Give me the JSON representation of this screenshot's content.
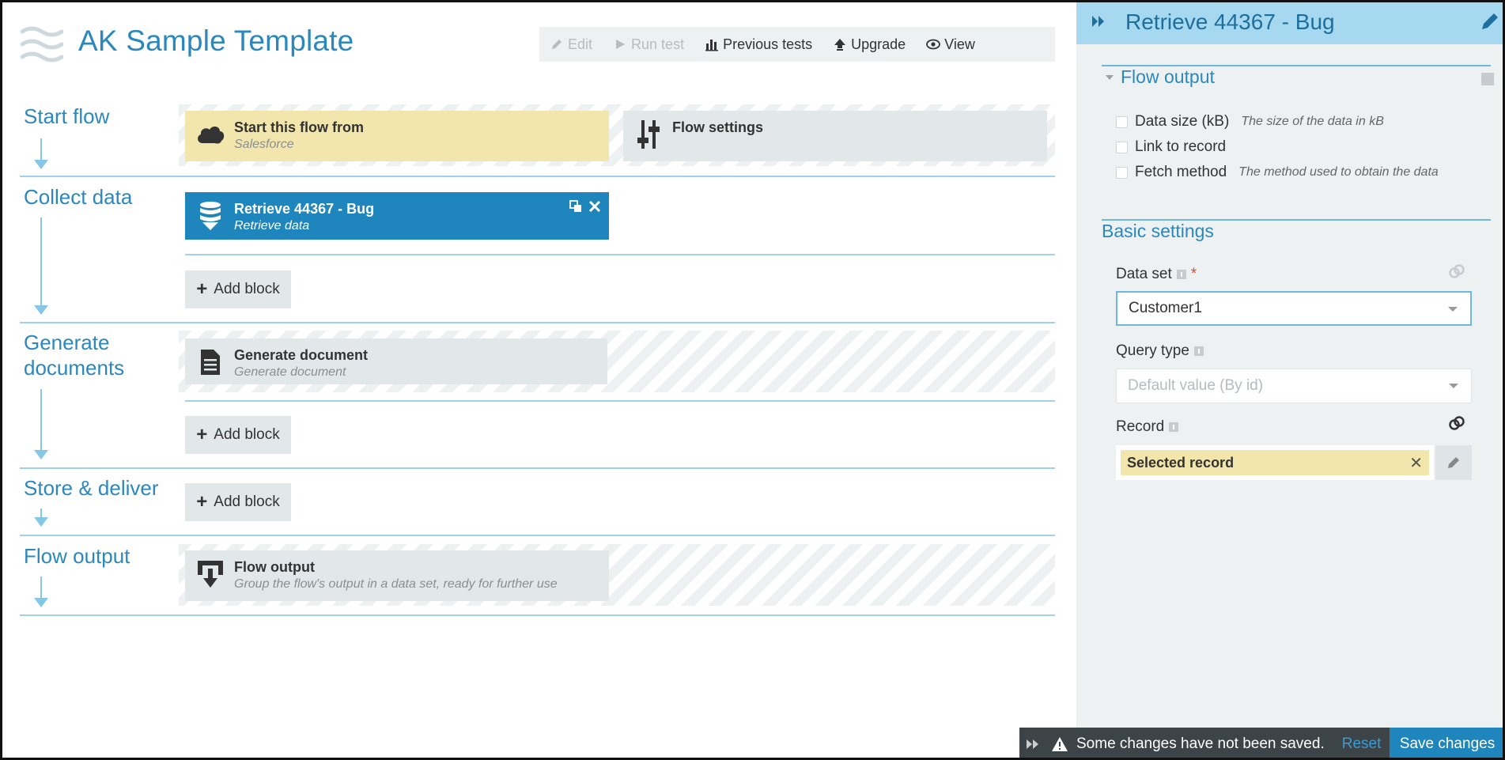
{
  "app": {
    "title": "AK Sample Template"
  },
  "toolbar": {
    "edit": "Edit",
    "run_test": "Run test",
    "previous_tests": "Previous tests",
    "upgrade": "Upgrade",
    "view": "View"
  },
  "stages": {
    "start": {
      "label": "Start flow"
    },
    "collect": {
      "label": "Collect data"
    },
    "generate": {
      "label": "Generate documents"
    },
    "store": {
      "label": "Store & deliver"
    },
    "output": {
      "label": "Flow output"
    }
  },
  "blocks": {
    "start_from": {
      "title": "Start this flow from",
      "subtitle": "Salesforce"
    },
    "flow_settings": {
      "title": "Flow settings"
    },
    "retrieve": {
      "title": "Retrieve 44367 - Bug",
      "subtitle": "Retrieve data"
    },
    "generate_doc": {
      "title": "Generate document",
      "subtitle": "Generate document"
    },
    "flow_output": {
      "title": "Flow output",
      "subtitle": "Group the flow's output in a data set, ready for further use"
    }
  },
  "add_block_label": "Add block",
  "panel": {
    "title": "Retrieve 44367 - Bug",
    "flow_output_section": {
      "title": "Flow output",
      "options": [
        {
          "label": "Data size (kB)",
          "description": "The size of the data in kB"
        },
        {
          "label": "Link to record",
          "description": ""
        },
        {
          "label": "Fetch method",
          "description": "The method used to obtain the data"
        }
      ]
    },
    "basic_settings": {
      "title": "Basic settings",
      "data_set_label": "Data set",
      "required_mark": "*",
      "data_set_value": "Customer1",
      "query_type_label": "Query type",
      "query_type_value": "Default value (By id)",
      "record_label": "Record",
      "record_value": "Selected record",
      "record_clear": "✕"
    }
  },
  "status_bar": {
    "message": "Some changes have not been saved.",
    "reset": "Reset",
    "save": "Save changes"
  },
  "colors": {
    "accent": "#2a88be",
    "block_blue": "#1f86bd",
    "block_yellow": "#f2e6ac",
    "panel_bg": "#edf1f2",
    "panel_header": "#a6d8ef"
  }
}
